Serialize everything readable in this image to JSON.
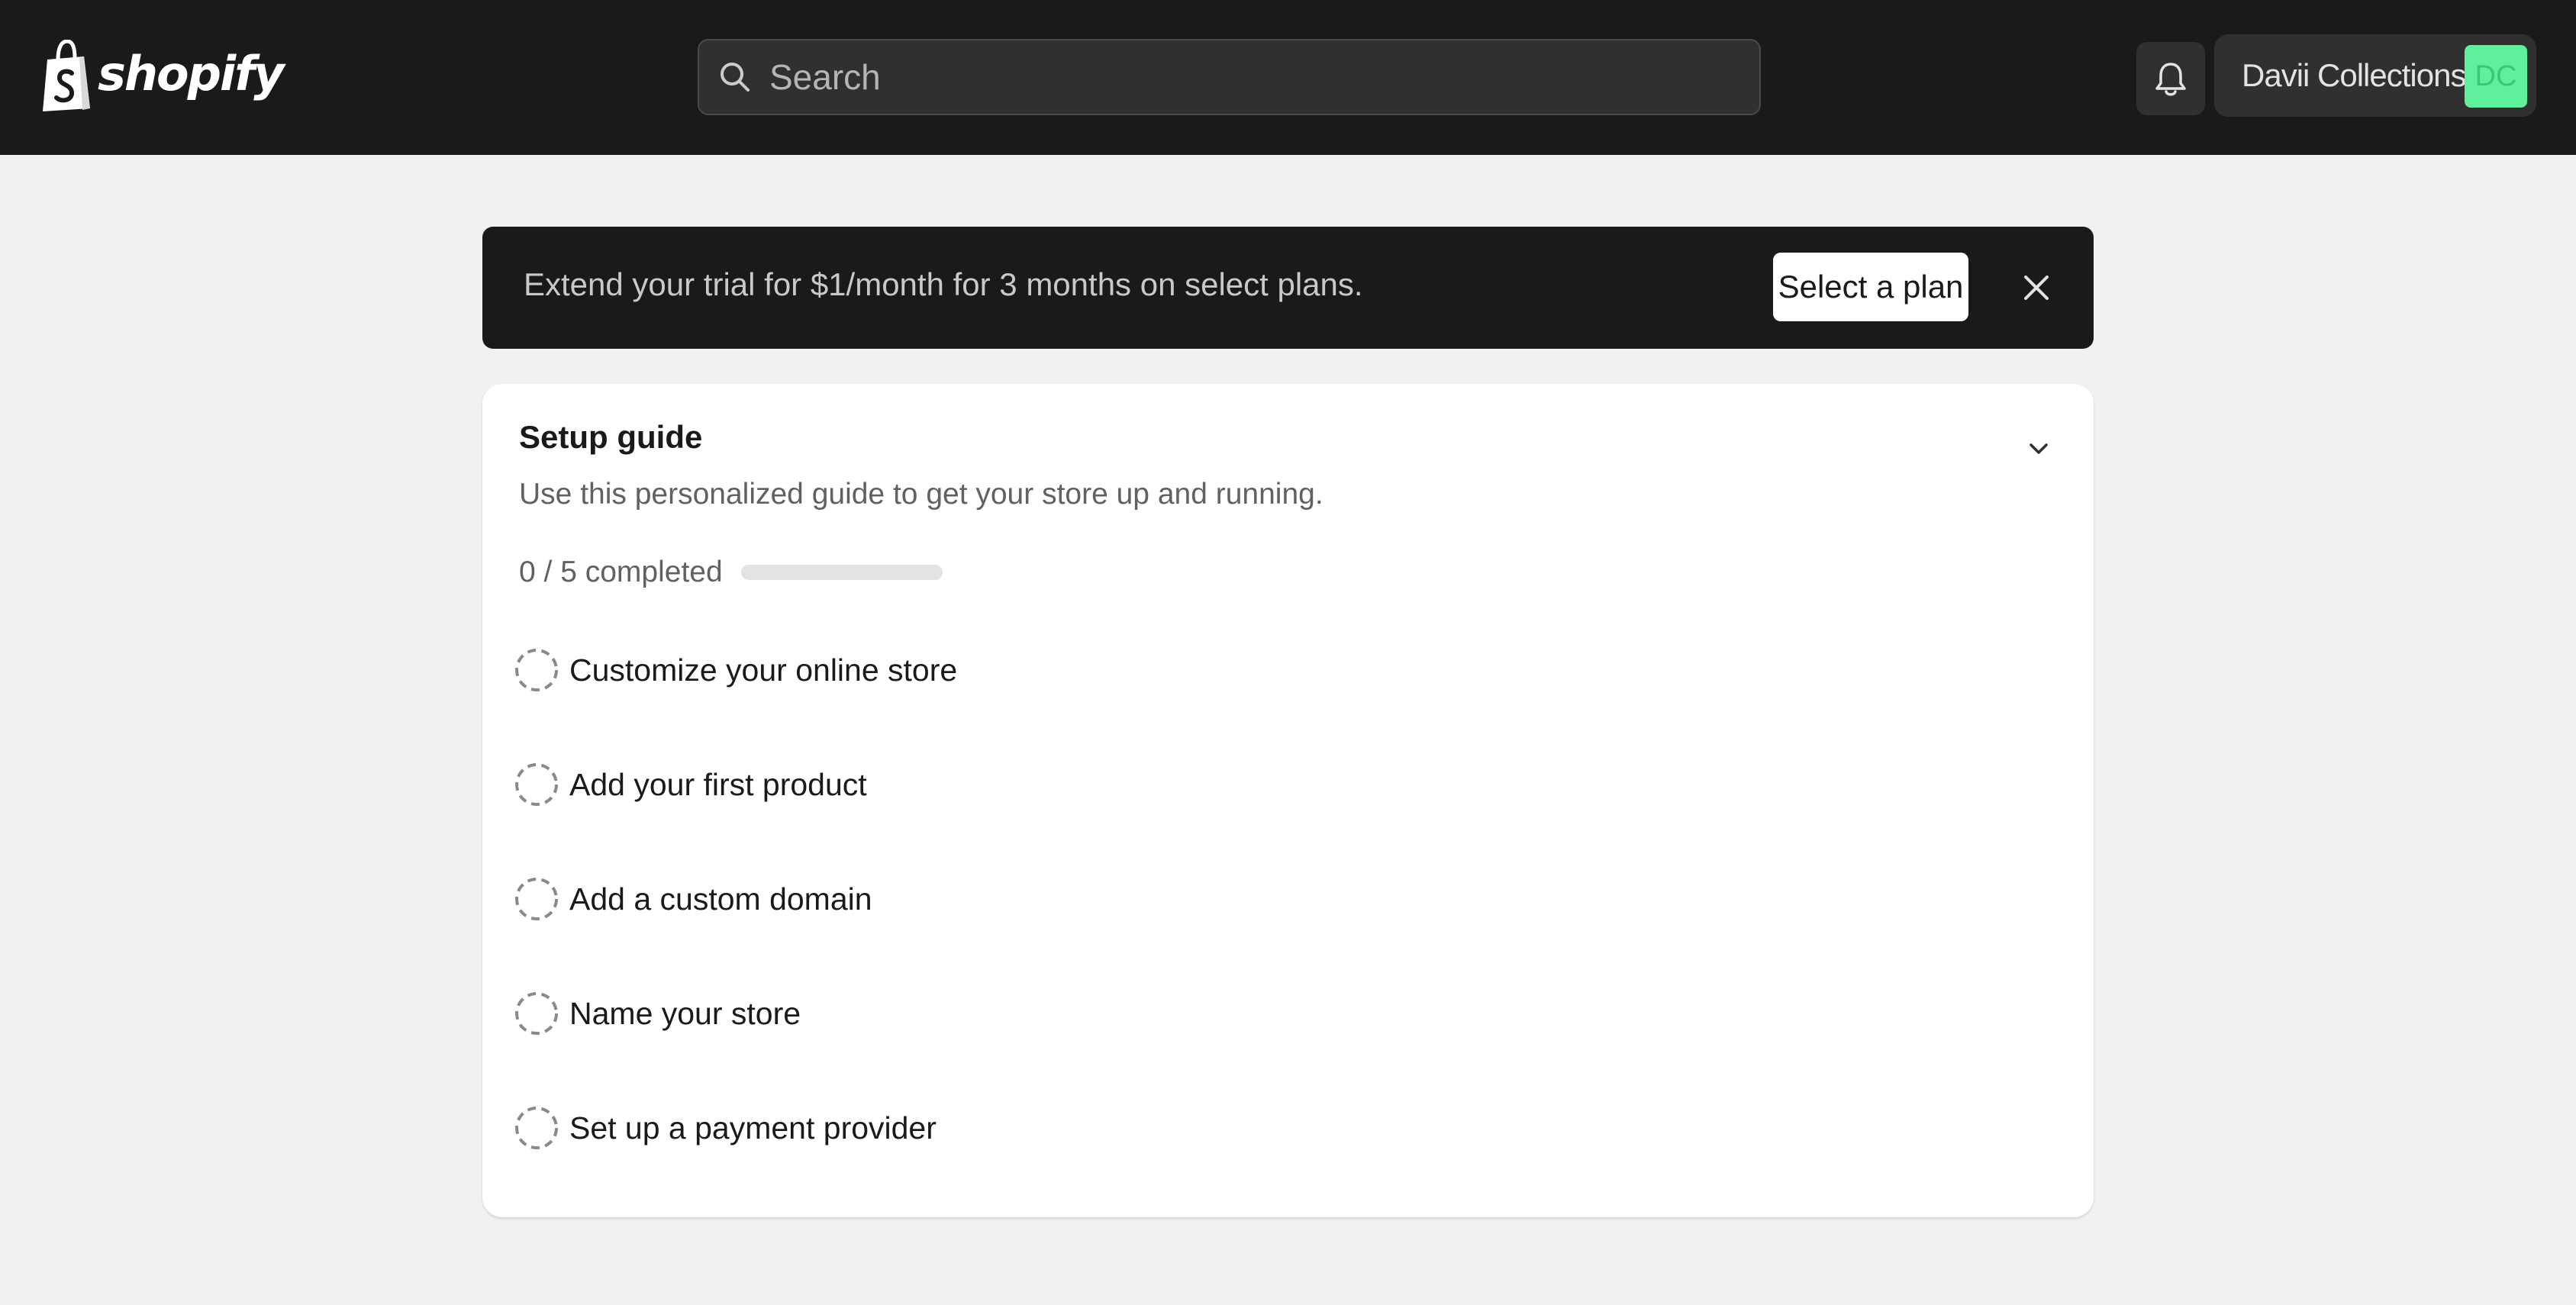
{
  "header": {
    "logo_icon": "shopify-bag-icon",
    "logo_text": "shopify",
    "search": {
      "icon": "search-icon",
      "placeholder": "Search",
      "value": ""
    },
    "notifications_icon": "bell-icon",
    "store": {
      "name": "Davii Collections",
      "initials": "DC"
    }
  },
  "banner": {
    "text": "Extend your trial for $1/month for 3 months on select plans.",
    "button_label": "Select a plan",
    "dismiss_icon": "close-icon"
  },
  "setup_guide": {
    "title": "Setup guide",
    "subtitle": "Use this personalized guide to get your store up and running.",
    "progress_text": "0 / 5 completed",
    "progress_fraction": 0,
    "collapse_icon": "chevron-down-icon",
    "tasks": [
      {
        "label": "Customize your online store",
        "completed": false
      },
      {
        "label": "Add your first product",
        "completed": false
      },
      {
        "label": "Add a custom domain",
        "completed": false
      },
      {
        "label": "Name your store",
        "completed": false
      },
      {
        "label": "Set up a payment provider",
        "completed": false
      }
    ]
  },
  "colors": {
    "topbar_bg": "#1a1a1a",
    "page_bg": "#f1f1f1",
    "avatar_bg": "#5ff09a",
    "avatar_text": "#38c973"
  }
}
